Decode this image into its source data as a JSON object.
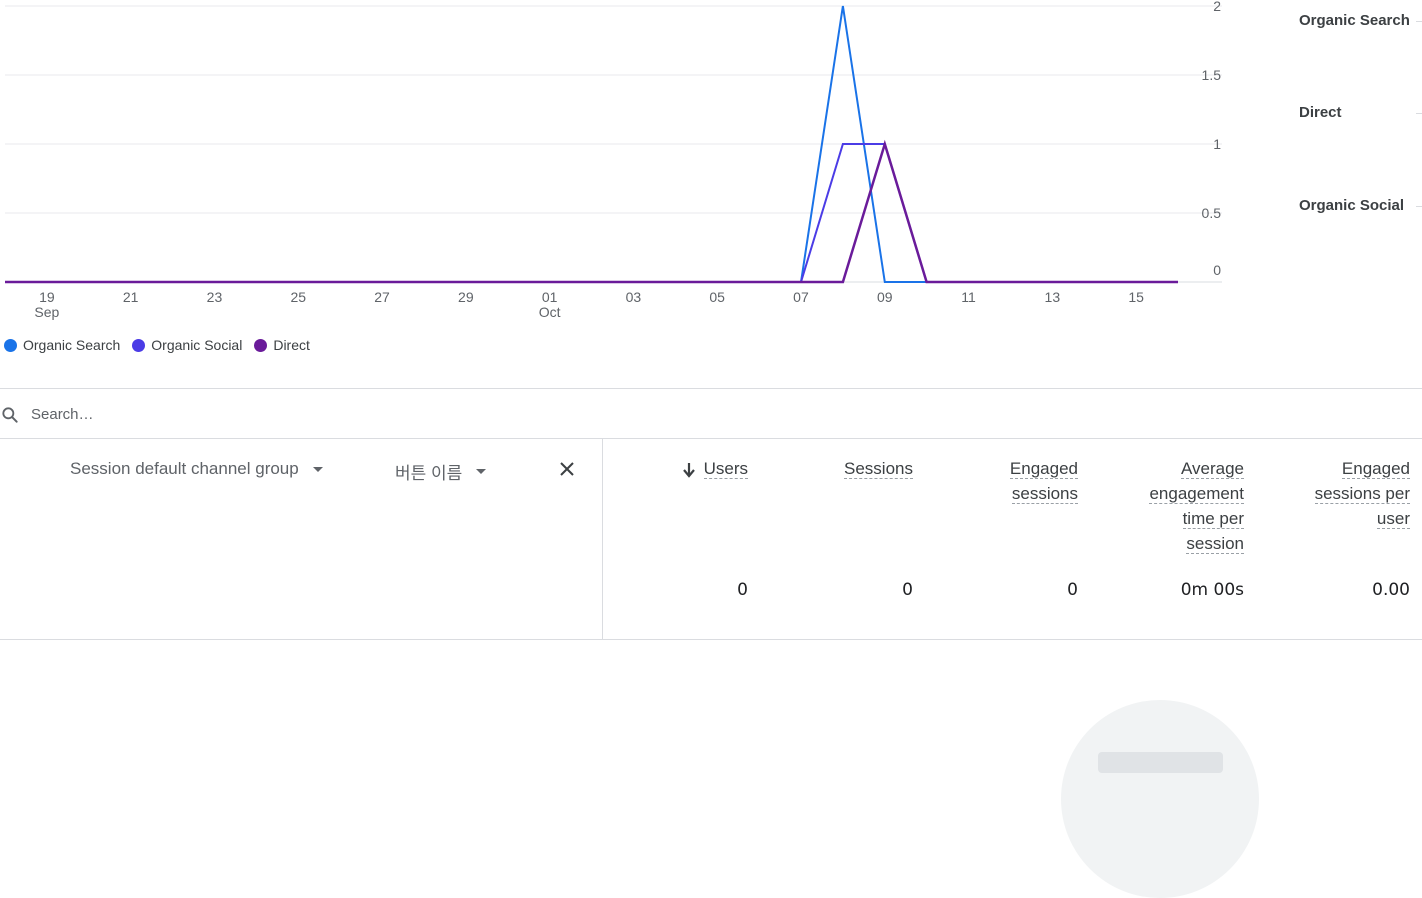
{
  "chart_data": {
    "type": "line",
    "x_ticks": [
      {
        "day": "19",
        "month": "Sep"
      },
      {
        "day": "21"
      },
      {
        "day": "23"
      },
      {
        "day": "25"
      },
      {
        "day": "27"
      },
      {
        "day": "29"
      },
      {
        "day": "01",
        "month": "Oct"
      },
      {
        "day": "03"
      },
      {
        "day": "05"
      },
      {
        "day": "07"
      },
      {
        "day": "09"
      },
      {
        "day": "11"
      },
      {
        "day": "13"
      },
      {
        "day": "15"
      }
    ],
    "y_ticks": [
      "2",
      "1.5",
      "1",
      "0.5",
      "0"
    ],
    "ylim": [
      0,
      2
    ],
    "x_dates": [
      "Sep 18",
      "Sep 19",
      "Sep 20",
      "Sep 21",
      "Sep 22",
      "Sep 23",
      "Sep 24",
      "Sep 25",
      "Sep 26",
      "Sep 27",
      "Sep 28",
      "Sep 29",
      "Sep 30",
      "Oct 01",
      "Oct 02",
      "Oct 03",
      "Oct 04",
      "Oct 05",
      "Oct 06",
      "Oct 07",
      "Oct 08",
      "Oct 09",
      "Oct 10",
      "Oct 11",
      "Oct 12",
      "Oct 13",
      "Oct 14",
      "Oct 15",
      "Oct 16"
    ],
    "series": [
      {
        "name": "Organic Search",
        "color": "#1a73e8",
        "values": [
          0,
          0,
          0,
          0,
          0,
          0,
          0,
          0,
          0,
          0,
          0,
          0,
          0,
          0,
          0,
          0,
          0,
          0,
          0,
          0,
          2,
          0,
          0,
          0,
          0,
          0,
          0,
          0,
          0
        ]
      },
      {
        "name": "Organic Social",
        "color": "#4b3ce6",
        "values": [
          0,
          0,
          0,
          0,
          0,
          0,
          0,
          0,
          0,
          0,
          0,
          0,
          0,
          0,
          0,
          0,
          0,
          0,
          0,
          0,
          1,
          1,
          0,
          0,
          0,
          0,
          0,
          0,
          0
        ]
      },
      {
        "name": "Direct",
        "color": "#6a1b9a",
        "values": [
          0,
          0,
          0,
          0,
          0,
          0,
          0,
          0,
          0,
          0,
          0,
          0,
          0,
          0,
          0,
          0,
          0,
          0,
          0,
          0,
          0,
          1,
          0,
          0,
          0,
          0,
          0,
          0,
          0
        ]
      }
    ],
    "grid": true,
    "legend": "bottom-left"
  },
  "right_panel": {
    "labels": [
      "Organic Search",
      "Direct",
      "Organic Social"
    ]
  },
  "legend": {
    "items": [
      {
        "label": "Organic Search",
        "color": "#1a73e8"
      },
      {
        "label": "Organic Social",
        "color": "#4b3ce6"
      },
      {
        "label": "Direct",
        "color": "#6a1b9a"
      }
    ]
  },
  "search": {
    "placeholder": "Search…",
    "value": ""
  },
  "table": {
    "dimension": "Session default channel group",
    "secondary_dimension": "버튼 이름",
    "metrics": [
      {
        "lines": [
          "Users"
        ],
        "value": "0",
        "sorted": true
      },
      {
        "lines": [
          "Sessions"
        ],
        "value": "0"
      },
      {
        "lines": [
          "Engaged",
          "sessions"
        ],
        "value": "0"
      },
      {
        "lines": [
          "Average",
          "engagement",
          "time per",
          "session"
        ],
        "value": "0m 00s"
      },
      {
        "lines": [
          "Engaged",
          "sessions per",
          "user"
        ],
        "value": "0.00"
      }
    ]
  }
}
